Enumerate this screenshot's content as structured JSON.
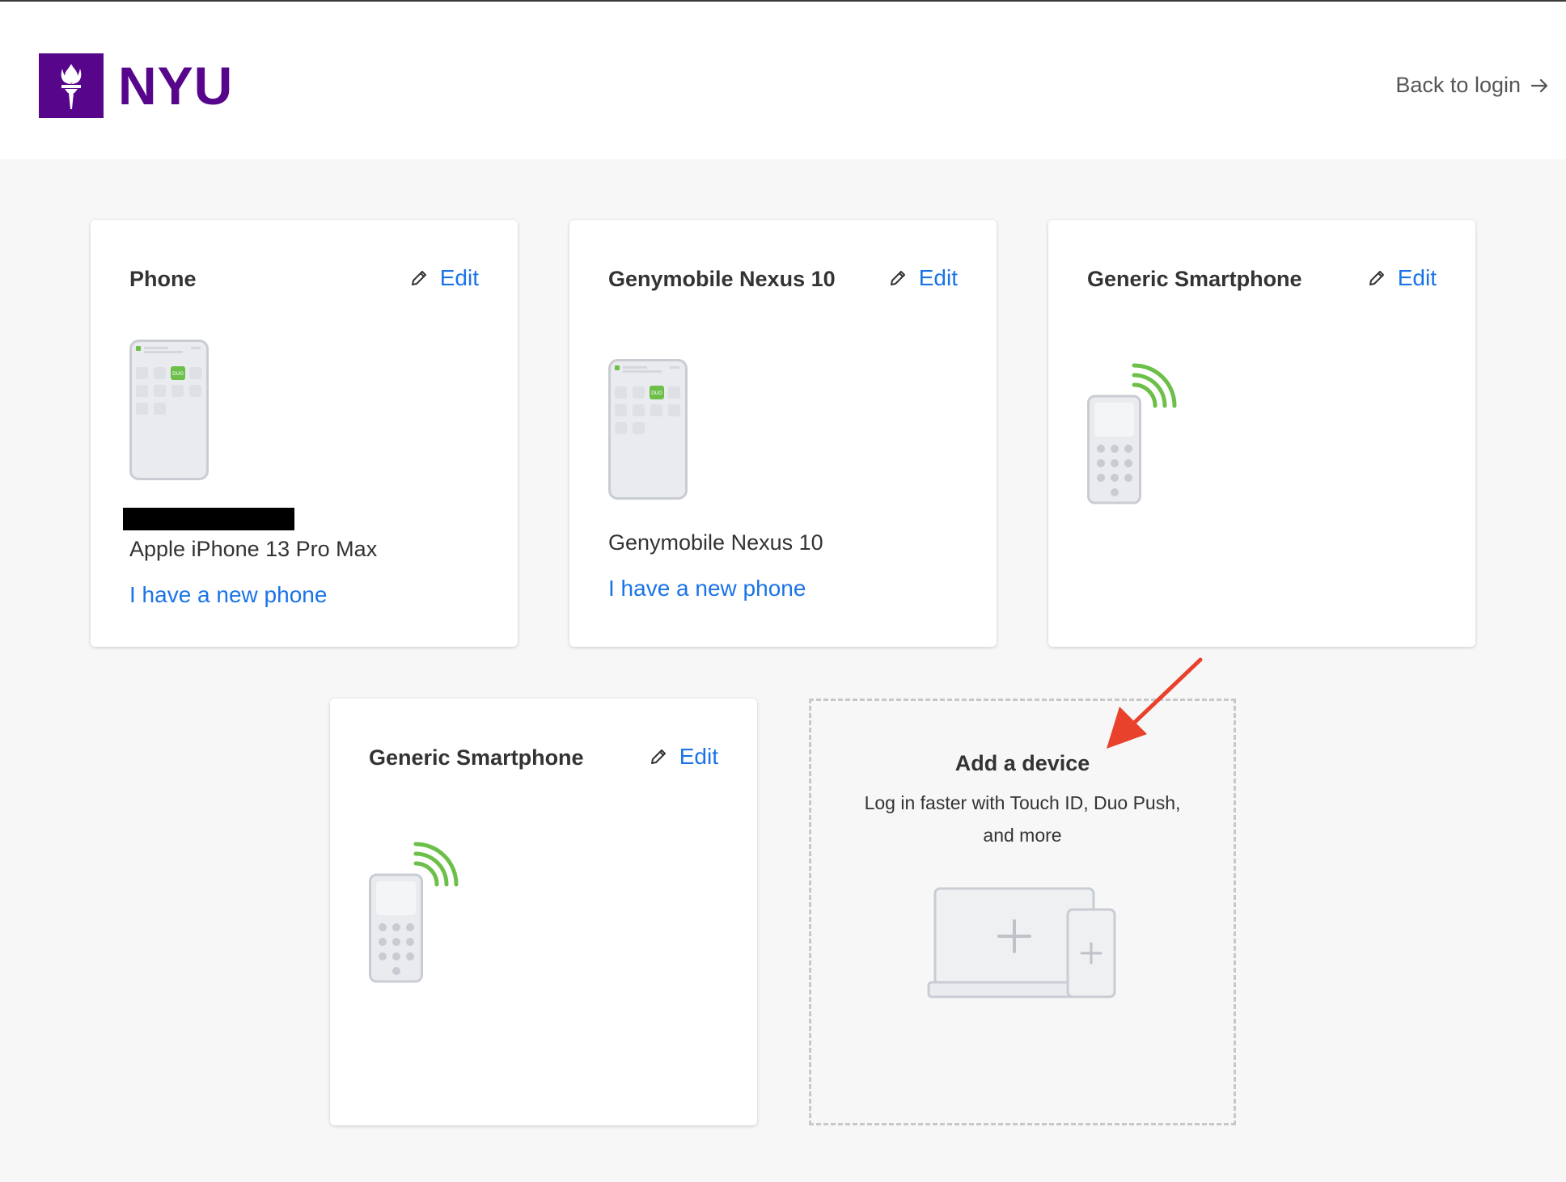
{
  "header": {
    "logo_text": "NYU",
    "back_link": "Back to login",
    "brand_color": "#57068c"
  },
  "cards": [
    {
      "title": "Phone",
      "edit": "Edit",
      "model": "Apple iPhone 13 Pro Max",
      "new_phone": "I have a new phone",
      "icon": "duo-mobile-phone-icon"
    },
    {
      "title": "Genymobile Nexus 10",
      "edit": "Edit",
      "model": "Genymobile Nexus 10",
      "new_phone": "I have a new phone",
      "icon": "duo-mobile-phone-icon"
    },
    {
      "title": "Generic Smartphone",
      "edit": "Edit",
      "icon": "sms-phone-icon"
    },
    {
      "title": "Generic Smartphone",
      "edit": "Edit",
      "icon": "sms-phone-icon"
    }
  ],
  "add_device": {
    "title": "Add a device",
    "description": "Log in faster with Touch ID, Duo Push, and more",
    "icon": "add-device-icon"
  },
  "colors": {
    "link": "#1a73e8",
    "signal": "#6cc04a",
    "annotation_arrow": "#e8412c"
  }
}
